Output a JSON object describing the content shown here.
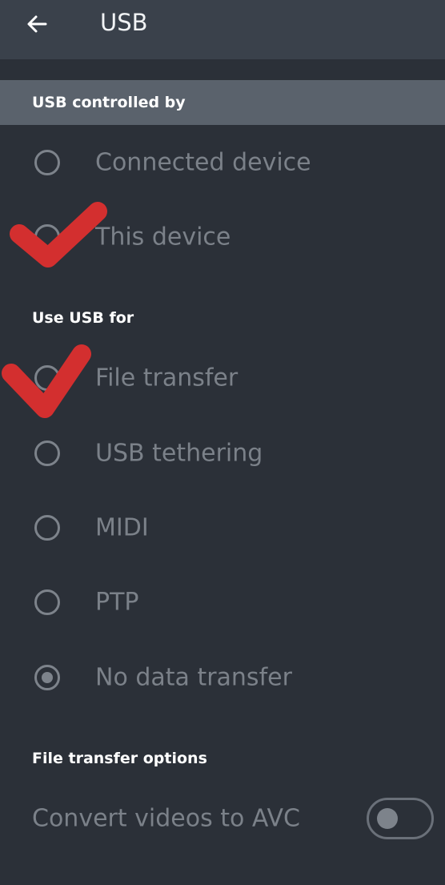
{
  "header": {
    "title": "USB",
    "back_icon": "arrow-left-icon"
  },
  "usb_controlled_by": {
    "heading": "USB controlled by",
    "options": [
      {
        "label": "Connected device",
        "selected": false
      },
      {
        "label": "This device",
        "selected": false
      }
    ]
  },
  "use_usb_for": {
    "heading": "Use USB for",
    "options": [
      {
        "label": "File transfer",
        "selected": false
      },
      {
        "label": "USB tethering",
        "selected": false
      },
      {
        "label": "MIDI",
        "selected": false
      },
      {
        "label": "PTP",
        "selected": false
      },
      {
        "label": "No data transfer",
        "selected": true
      }
    ]
  },
  "file_transfer_options": {
    "heading": "File transfer options",
    "convert_videos_label": "Convert videos to AVC",
    "convert_videos_on": false
  },
  "colors": {
    "background": "#2b3038",
    "appbar": "#3a414b",
    "section_band": "#5a626c",
    "disabled_text": "#7b8189",
    "annotation_red": "#d32f2f"
  }
}
